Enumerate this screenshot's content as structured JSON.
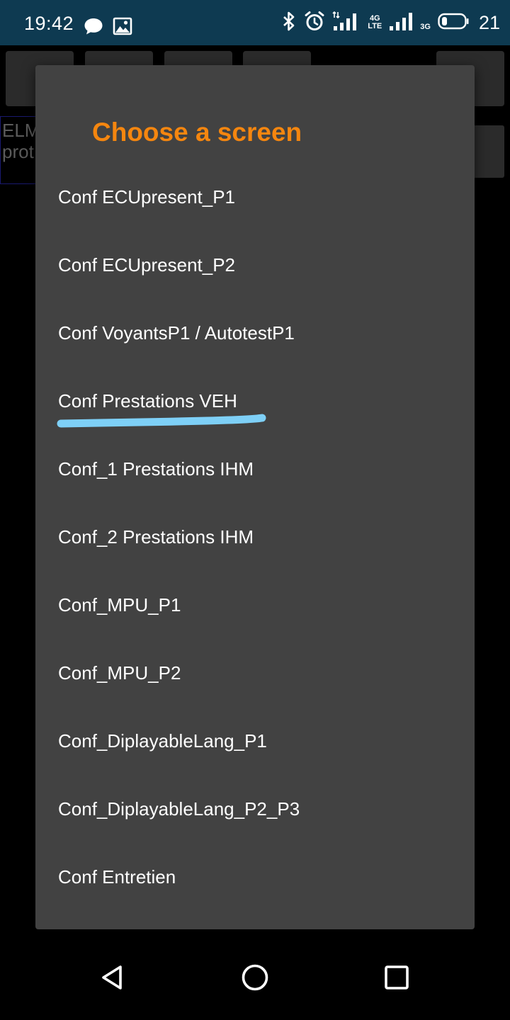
{
  "status_bar": {
    "time": "19:42",
    "network_1_label": "4G",
    "network_1_sublabel": "LTE",
    "network_2_label": "3G",
    "battery_level": "21",
    "icons": [
      "chat-bubble-icon",
      "image-icon",
      "bluetooth-icon",
      "alarm-icon",
      "signal-icon",
      "signal-icon",
      "battery-icon"
    ]
  },
  "background_app": {
    "text_line_1": "ELM",
    "text_line_2": "prot"
  },
  "dialog": {
    "title": "Choose a screen",
    "title_color": "#f5860f",
    "items": [
      {
        "label": "Conf ECUpresent_P1"
      },
      {
        "label": "Conf ECUpresent_P2"
      },
      {
        "label": "Conf VoyantsP1 / AutotestP1"
      },
      {
        "label": "Conf Prestations VEH",
        "highlighted": true
      },
      {
        "label": "Conf_1 Prestations IHM"
      },
      {
        "label": "Conf_2 Prestations IHM"
      },
      {
        "label": "Conf_MPU_P1"
      },
      {
        "label": "Conf_MPU_P2"
      },
      {
        "label": "Conf_DiplayableLang_P1"
      },
      {
        "label": "Conf_DiplayableLang_P2_P3"
      },
      {
        "label": "Conf Entretien"
      }
    ],
    "highlight_color": "#7ed0f7"
  },
  "nav_bar": {
    "icons": [
      "back-icon",
      "home-icon",
      "recents-icon"
    ]
  }
}
